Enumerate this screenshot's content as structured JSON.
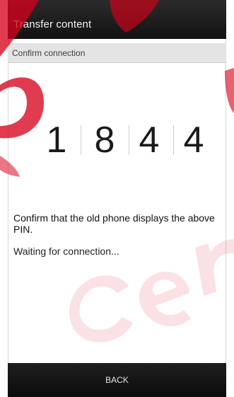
{
  "header": {
    "title": "Transfer content"
  },
  "subheader": {
    "label": "Confirm connection"
  },
  "pin": {
    "digits": [
      "1",
      "8",
      "4",
      "4"
    ]
  },
  "message": {
    "text": "Confirm that the old phone displays the above PIN."
  },
  "status": {
    "text": "Waiting for connection..."
  },
  "footer": {
    "back_label": "BACK"
  },
  "colors": {
    "watermark": "#d8001a",
    "bar_bg": "#151515"
  }
}
